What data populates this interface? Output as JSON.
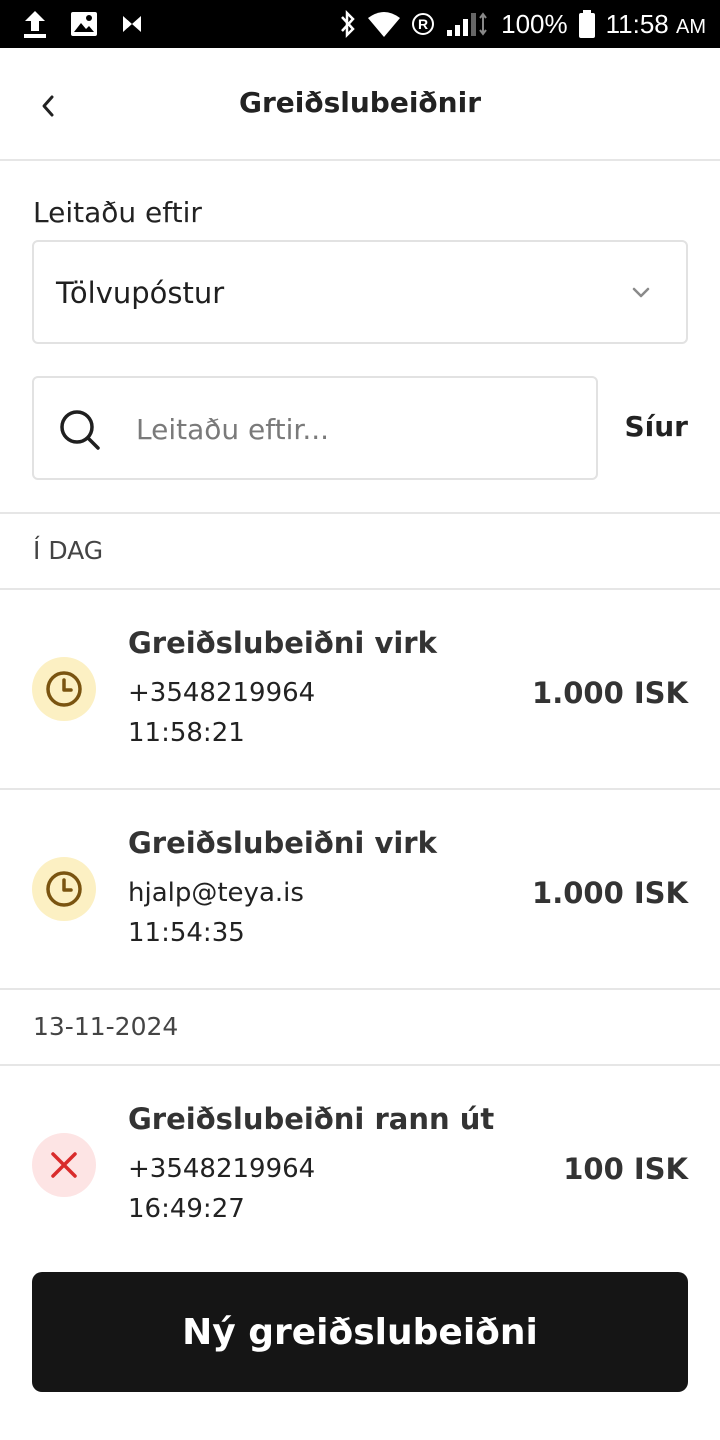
{
  "status_bar": {
    "battery": "100%",
    "time": "11:58",
    "ampm": "AM",
    "icons": [
      "upload-icon",
      "image-icon",
      "app-icon",
      "bluetooth-icon",
      "wifi-icon",
      "roaming-icon",
      "signal-icon",
      "battery-icon"
    ]
  },
  "header": {
    "title": "Greiðslubeiðnir"
  },
  "search": {
    "label": "Leitaðu eftir",
    "select_value": "Tölvupóstur",
    "placeholder": "Leitaðu eftir...",
    "filters_label": "Síur"
  },
  "sections": [
    {
      "heading": "Í DAG",
      "items": [
        {
          "title": "Greiðslubeiðni virk",
          "contact": "+3548219964",
          "time": "11:58:21",
          "amount": "1.000 ISK",
          "status": "pending"
        },
        {
          "title": "Greiðslubeiðni virk",
          "contact": "hjalp@teya.is",
          "time": "11:54:35",
          "amount": "1.000 ISK",
          "status": "pending"
        }
      ]
    },
    {
      "heading": "13-11-2024",
      "items": [
        {
          "title": "Greiðslubeiðni rann út",
          "contact": "+3548219964",
          "time": "16:49:27",
          "amount": "100 ISK",
          "status": "expired"
        }
      ]
    }
  ],
  "cta": {
    "label": "Ný greiðslubeiðni"
  },
  "colors": {
    "pending_bg": "#fcf0c3",
    "pending_icon": "#7a5410",
    "expired_bg": "#fde4e4",
    "expired_icon": "#d92b2b",
    "cta_bg": "#151515"
  }
}
